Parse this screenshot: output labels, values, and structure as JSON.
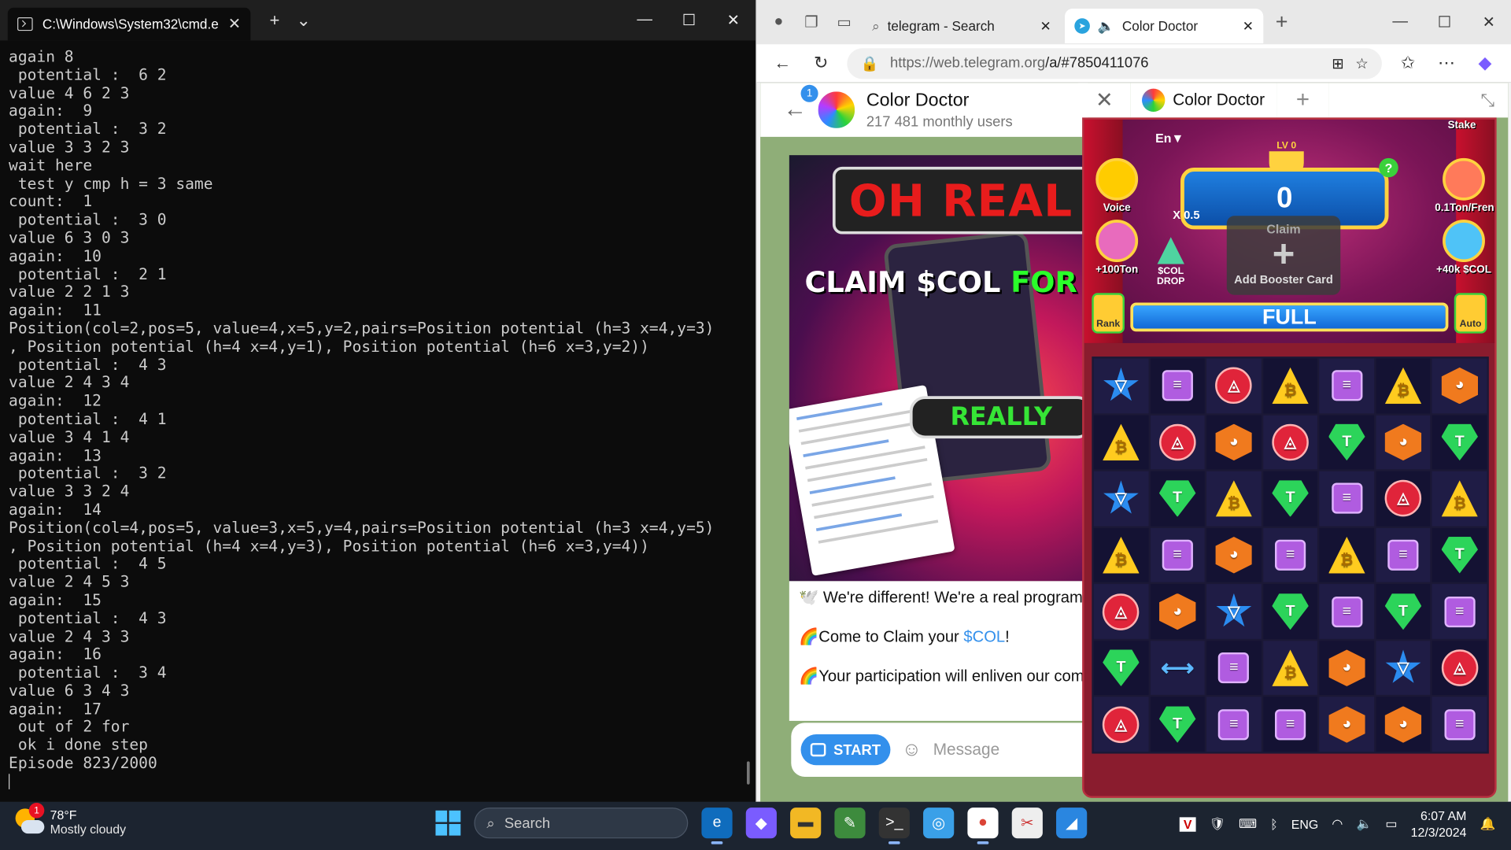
{
  "cmd": {
    "title": "C:\\Windows\\System32\\cmd.e",
    "lines": [
      "again 8",
      " potential :  6 2",
      "value 4 6 2 3",
      "again:  9",
      " potential :  3 2",
      "value 3 3 2 3",
      "wait here",
      " test y cmp h = 3 same",
      "count:  1",
      " potential :  3 0",
      "value 6 3 0 3",
      "again:  10",
      " potential :  2 1",
      "value 2 2 1 3",
      "again:  11",
      "Position(col=2,pos=5, value=4,x=5,y=2,pairs=Position potential (h=3 x=4,y=3)",
      ", Position potential (h=4 x=4,y=1), Position potential (h=6 x=3,y=2))",
      " potential :  4 3",
      "value 2 4 3 4",
      "again:  12",
      " potential :  4 1",
      "value 3 4 1 4",
      "again:  13",
      " potential :  3 2",
      "value 3 3 2 4",
      "again:  14",
      "Position(col=4,pos=5, value=3,x=5,y=4,pairs=Position potential (h=3 x=4,y=5)",
      ", Position potential (h=4 x=4,y=3), Position potential (h=6 x=3,y=4))",
      " potential :  4 5",
      "value 2 4 5 3",
      "again:  15",
      " potential :  4 3",
      "value 2 4 3 3",
      "again:  16",
      " potential :  3 4",
      "value 6 3 4 3",
      "again:  17",
      " out of 2 for",
      " ok i done step",
      "Episode 823/2000"
    ]
  },
  "browser": {
    "tab1_label": "telegram - Search",
    "tab2_label": "Color Doctor",
    "url_host": "https://web.telegram.org",
    "url_path": "/a/#7850411076"
  },
  "telegram": {
    "back_badge": "1",
    "channel_name": "Color Doctor",
    "channel_sub": "217 481 monthly users",
    "post_banner1": "OH REAL",
    "post_banner2_a": "CLAIM $COL ",
    "post_banner2_b": "FOR",
    "post_banner3": "REALLY",
    "post_line1": "🕊️ We're different! We're a real program!",
    "post_line2_a": "🌈Come to Claim your ",
    "post_line2_link": "$COL",
    "post_line2_b": "!",
    "post_line3": "🌈Your participation will enliven our com",
    "start_label": "START",
    "message_placeholder": "Message"
  },
  "miniapp": {
    "tab_label": "Color Doctor",
    "lang": "En▼",
    "voice": "Voice",
    "stake": "Stake",
    "ton_fren": "0.1Ton/Fren",
    "plus_ton": "+100Ton",
    "plus_col": "+40k $COL",
    "level": "LV 0",
    "score": "0",
    "multiplier": "X 0.5",
    "drop": "$COL DROP",
    "claim": "Claim",
    "booster": "Add Booster Card",
    "rank": "Rank",
    "auto": "Auto",
    "full": "FULL",
    "board": [
      [
        "ton-star",
        "scroll-sq",
        "trx-circle",
        "btc-tri",
        "scroll-sq",
        "btc-tri",
        "shiba-hex"
      ],
      [
        "btc-tri",
        "trx-circle",
        "shiba-hex",
        "trx-circle",
        "usdt-gem",
        "shiba-hex",
        "usdt-gem"
      ],
      [
        "ton-star",
        "usdt-gem",
        "btc-tri",
        "usdt-gem",
        "scroll-sq",
        "trx-circle",
        "btc-tri"
      ],
      [
        "btc-tri",
        "scroll-sq",
        "shiba-hex",
        "scroll-sq",
        "btc-tri",
        "scroll-sq",
        "usdt-gem"
      ],
      [
        "trx-circle",
        "shiba-hex",
        "ton-star",
        "usdt-gem",
        "scroll-sq",
        "usdt-gem",
        "scroll-sq"
      ],
      [
        "usdt-gem",
        "bomb-arrow",
        "scroll-sq",
        "btc-tri",
        "shiba-hex",
        "ton-star",
        "trx-circle"
      ],
      [
        "trx-circle",
        "usdt-gem",
        "scroll-sq",
        "scroll-sq",
        "shiba-hex",
        "shiba-hex",
        "scroll-sq"
      ]
    ]
  },
  "taskbar": {
    "weather_badge": "1",
    "temp": "78°F",
    "condition": "Mostly cloudy",
    "search_label": "Search",
    "lang": "ENG",
    "time": "6:07 AM",
    "date": "12/3/2024"
  }
}
